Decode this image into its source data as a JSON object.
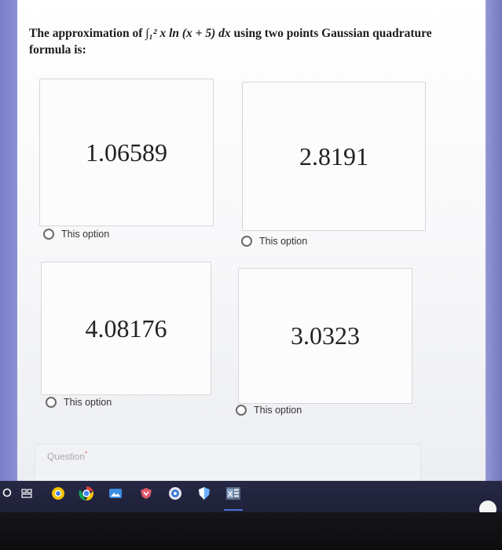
{
  "question": {
    "prefix": "The approximation of ",
    "math": "∫₁² x ln (x + 5) dx",
    "suffix": " using two points Gaussian quadrature formula is:"
  },
  "options": [
    {
      "value": "1.06589",
      "label": "This option"
    },
    {
      "value": "2.8191",
      "label": "This option"
    },
    {
      "value": "4.08176",
      "label": "This option"
    },
    {
      "value": "3.0323",
      "label": "This option"
    }
  ],
  "next_question": {
    "label": "Question",
    "required_mark": "*"
  },
  "taskbar": {
    "icons": [
      "search-icon",
      "task-view-icon",
      "chrome-icon",
      "google-chrome-icon",
      "photos-icon",
      "brave-icon",
      "settings-icon",
      "shield-icon",
      "excel-icon"
    ],
    "accent": "#4a6fd1"
  }
}
